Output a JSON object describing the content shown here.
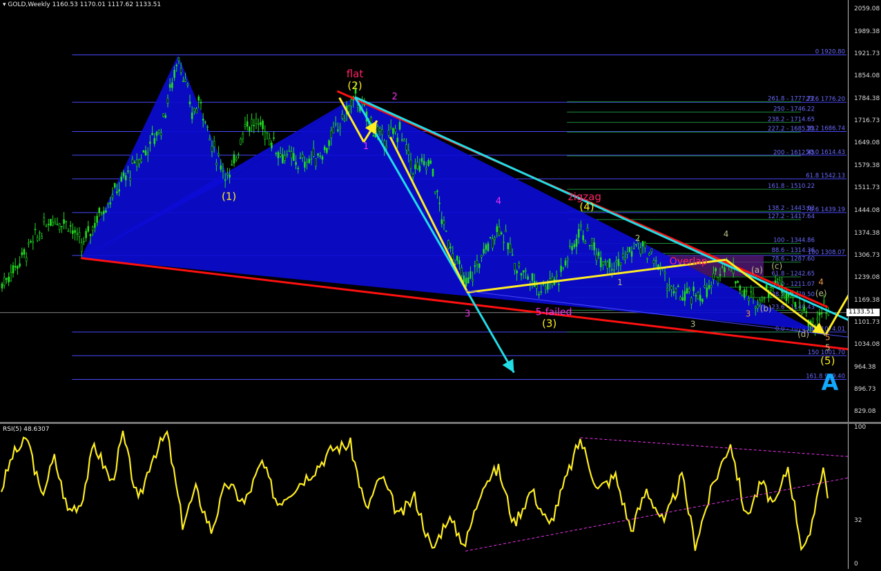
{
  "header": {
    "symbol": "GOLD,Weekly",
    "open": "1160.53",
    "high": "1170.01",
    "low": "1117.62",
    "close": "1133.51"
  },
  "rsi_header": "RSI(5) 48.6307",
  "colors": {
    "candle": "#22dd22",
    "blue_fill": "#0b0bd6",
    "red_line": "#ff1010",
    "cyan": "#22dde6",
    "yellow": "#ffee22",
    "magenta": "#ee33ee",
    "fib_line": "#4a4aff",
    "rsi": "#ffee22"
  },
  "price_scale": [
    "2059.08",
    "1989.38",
    "1921.73",
    "1854.08",
    "1784.38",
    "1716.73",
    "1649.08",
    "1579.38",
    "1511.73",
    "1444.08",
    "1374.38",
    "1306.73",
    "1239.08",
    "1169.38",
    "1101.73",
    "1034.08",
    "964.38",
    "896.73",
    "829.08"
  ],
  "current_price": "1133.51",
  "rsi_scale": [
    "100",
    "32",
    "0"
  ],
  "fib_left": [
    {
      "price": 1920.8,
      "label": "0  1920.80"
    },
    {
      "price": 1776.2,
      "label": "23.6  1776.20"
    },
    {
      "price": 1686.74,
      "label": "38.2  1686.74"
    },
    {
      "price": 1614.43,
      "label": "50.0  1614.43"
    },
    {
      "price": 1542.13,
      "label": "61.8  1542.13"
    },
    {
      "price": 1439.19,
      "label": "78.6  1439.19"
    },
    {
      "price": 1308.07,
      "label": "100  1308.07"
    },
    {
      "price": 1074.01,
      "label": "138.2  1074.01"
    },
    {
      "price": 1001.7,
      "label": "150  1001.70"
    },
    {
      "price": 929.4,
      "label": "161.8  929.40"
    }
  ],
  "fib_right": [
    {
      "price": 1777.72,
      "label": "261.8 - 1777.72"
    },
    {
      "price": 1746.22,
      "label": "250 - 1746.22"
    },
    {
      "price": 1714.65,
      "label": "238.2 - 1714.65"
    },
    {
      "price": 1685.23,
      "label": "227.2 - 1685.23"
    },
    {
      "price": 1612.45,
      "label": "200 - 1612.45"
    },
    {
      "price": 1510.22,
      "label": "161.8 - 1510.22"
    },
    {
      "price": 1443.03,
      "label": "138.2 - 1443.03"
    },
    {
      "price": 1417.64,
      "label": "127.2 - 1417.64"
    },
    {
      "price": 1344.86,
      "label": "100 - 1344.86"
    },
    {
      "price": 1314.36,
      "label": "88.6 - 1314.36"
    },
    {
      "price": 1287.6,
      "label": "78.6 - 1287.60"
    },
    {
      "price": 1242.65,
      "label": "61.8 - 1242.65"
    },
    {
      "price": 1211.07,
      "label": "50.0 - 1211.07"
    },
    {
      "price": 1179.5,
      "label": "38.2 - 1179.50"
    },
    {
      "price": 1140.43,
      "label": "23.6 - 1140.43"
    },
    {
      "price": 1074.01,
      "label": "0.0 - 1074.01"
    }
  ],
  "wave_labels": [
    {
      "text": "flat",
      "price": 1852,
      "bar": 160,
      "color": "#ff2266",
      "size": 15
    },
    {
      "text": "(2)",
      "price": 1816,
      "bar": 160,
      "color": "#ffee22",
      "size": 15
    },
    {
      "text": "2",
      "price": 1785,
      "bar": 178,
      "color": "#ee33ee",
      "size": 13
    },
    {
      "text": "1",
      "price": 1633,
      "bar": 165,
      "color": "#ee33ee",
      "size": 13
    },
    {
      "text": "(1)",
      "price": 1478,
      "bar": 103,
      "color": "#ffee22",
      "size": 15
    },
    {
      "text": "zigzag",
      "price": 1477,
      "bar": 264,
      "color": "#ff2266",
      "size": 15
    },
    {
      "text": "(4)",
      "price": 1446,
      "bar": 265,
      "color": "#ffee22",
      "size": 15
    },
    {
      "text": "4",
      "price": 1465,
      "bar": 225,
      "color": "#ee33ee",
      "size": 13
    },
    {
      "text": "3",
      "price": 1121,
      "bar": 211,
      "color": "#ee33ee",
      "size": 13
    },
    {
      "text": "5-failed",
      "price": 1126,
      "bar": 250,
      "color": "#ee33ee",
      "size": 14
    },
    {
      "text": "(3)",
      "price": 1090,
      "bar": 248,
      "color": "#ffee22",
      "size": 15
    },
    {
      "text": "2",
      "price": 1352,
      "bar": 288,
      "color": "#bbbb88",
      "size": 12
    },
    {
      "text": "1",
      "price": 1217,
      "bar": 280,
      "color": "#bbbb88",
      "size": 12
    },
    {
      "text": "Overlap",
      "price": 1281,
      "bar": 311,
      "color": "#ff2266",
      "size": 14
    },
    {
      "text": "4",
      "price": 1365,
      "bar": 328,
      "color": "#bbbb88",
      "size": 12
    },
    {
      "text": "(a)",
      "price": 1255,
      "bar": 342,
      "color": "#bbbb88",
      "size": 12
    },
    {
      "text": "(c)",
      "price": 1267,
      "bar": 351,
      "color": "#bbbb88",
      "size": 12
    },
    {
      "text": "(b)",
      "price": 1137,
      "bar": 346,
      "color": "#bbbb88",
      "size": 12
    },
    {
      "text": "3",
      "price": 1121,
      "bar": 338,
      "color": "#ee9944",
      "size": 12
    },
    {
      "text": "3",
      "price": 1090,
      "bar": 313,
      "color": "#bbbb88",
      "size": 12
    },
    {
      "text": "4",
      "price": 1218,
      "bar": 371,
      "color": "#ee9944",
      "size": 12
    },
    {
      "text": "(e)",
      "price": 1183,
      "bar": 371,
      "color": "#bbbb88",
      "size": 12
    },
    {
      "text": "(d)",
      "price": 1059,
      "bar": 363,
      "color": "#bbbb88",
      "size": 12
    },
    {
      "text": "5",
      "price": 1050,
      "bar": 374,
      "color": "#ee9944",
      "size": 12
    },
    {
      "text": "5",
      "price": 1018,
      "bar": 374,
      "color": "#bbbb88",
      "size": 12
    },
    {
      "text": "(5)",
      "price": 976,
      "bar": 374,
      "color": "#ffee22",
      "size": 15
    },
    {
      "text": "A",
      "price": 897,
      "bar": 375,
      "color": "#11aaff",
      "size": 32
    }
  ],
  "chart_data": {
    "type": "candlestick",
    "symbol": "GOLD",
    "timeframe": "Weekly",
    "ylim": [
      829.08,
      2059.08
    ],
    "price_anchors": [
      {
        "bar": 0,
        "price": 1220
      },
      {
        "bar": 12,
        "price": 1330
      },
      {
        "bar": 22,
        "price": 1420
      },
      {
        "bar": 30,
        "price": 1410
      },
      {
        "bar": 36,
        "price": 1335
      },
      {
        "bar": 44,
        "price": 1435
      },
      {
        "bar": 54,
        "price": 1530
      },
      {
        "bar": 62,
        "price": 1600
      },
      {
        "bar": 72,
        "price": 1700
      },
      {
        "bar": 80,
        "price": 1920
      },
      {
        "bar": 86,
        "price": 1740
      },
      {
        "bar": 90,
        "price": 1780
      },
      {
        "bar": 95,
        "price": 1640
      },
      {
        "bar": 103,
        "price": 1540
      },
      {
        "bar": 110,
        "price": 1715
      },
      {
        "bar": 118,
        "price": 1700
      },
      {
        "bar": 126,
        "price": 1620
      },
      {
        "bar": 135,
        "price": 1590
      },
      {
        "bar": 145,
        "price": 1620
      },
      {
        "bar": 152,
        "price": 1700
      },
      {
        "bar": 160,
        "price": 1792
      },
      {
        "bar": 166,
        "price": 1720
      },
      {
        "bar": 172,
        "price": 1660
      },
      {
        "bar": 180,
        "price": 1690
      },
      {
        "bar": 186,
        "price": 1570
      },
      {
        "bar": 194,
        "price": 1590
      },
      {
        "bar": 200,
        "price": 1390
      },
      {
        "bar": 210,
        "price": 1215
      },
      {
        "bar": 216,
        "price": 1290
      },
      {
        "bar": 225,
        "price": 1400
      },
      {
        "bar": 233,
        "price": 1275
      },
      {
        "bar": 243,
        "price": 1210
      },
      {
        "bar": 252,
        "price": 1245
      },
      {
        "bar": 262,
        "price": 1390
      },
      {
        "bar": 270,
        "price": 1310
      },
      {
        "bar": 278,
        "price": 1280
      },
      {
        "bar": 288,
        "price": 1340
      },
      {
        "bar": 296,
        "price": 1290
      },
      {
        "bar": 304,
        "price": 1190
      },
      {
        "bar": 312,
        "price": 1180
      },
      {
        "bar": 320,
        "price": 1200
      },
      {
        "bar": 328,
        "price": 1300
      },
      {
        "bar": 336,
        "price": 1190
      },
      {
        "bar": 342,
        "price": 1165
      },
      {
        "bar": 350,
        "price": 1230
      },
      {
        "bar": 358,
        "price": 1185
      },
      {
        "bar": 364,
        "price": 1130
      },
      {
        "bar": 368,
        "price": 1080
      },
      {
        "bar": 372,
        "price": 1160
      },
      {
        "bar": 374,
        "price": 1133
      }
    ],
    "bars_visible": 375,
    "patterns": [
      {
        "name": "blue-harmonic",
        "type": "polygon",
        "points": [
          [
            36,
            1300
          ],
          [
            80,
            1920
          ],
          [
            103,
            1540
          ],
          [
            160,
            1792
          ],
          [
            368,
            1080
          ]
        ]
      },
      {
        "name": "blue-harmonic-base",
        "type": "polygon",
        "points": [
          [
            36,
            1300
          ],
          [
            103,
            1540
          ],
          [
            160,
            1792
          ]
        ]
      }
    ],
    "lines": [
      {
        "name": "red-upper-trendline",
        "color": "#ff1010",
        "from": [
          152,
          1810
        ],
        "to": [
          374,
          1150
        ]
      },
      {
        "name": "cyan-upper-trendline",
        "color": "#22dde6",
        "from": [
          160,
          1792
        ],
        "to": [
          400,
          1060
        ]
      },
      {
        "name": "red-lower-trendline",
        "color": "#ff1010",
        "from": [
          36,
          1300
        ],
        "to": [
          410,
          1000
        ]
      },
      {
        "name": "cyan-wave3-line",
        "color": "#22dde6",
        "from": [
          160,
          1792
        ],
        "to": [
          232,
          950
        ]
      },
      {
        "name": "yellow-wave-1",
        "color": "#ffee22",
        "from": [
          153,
          1790
        ],
        "to": [
          164,
          1655
        ]
      },
      {
        "name": "yellow-wave-2",
        "color": "#ffee22",
        "from": [
          164,
          1655
        ],
        "to": [
          170,
          1720
        ]
      },
      {
        "name": "yellow-wave-3",
        "color": "#ffee22",
        "from": [
          176,
          1670
        ],
        "to": [
          211,
          1195
        ]
      },
      {
        "name": "yellow-wave-4",
        "color": "#ffee22",
        "from": [
          211,
          1195
        ],
        "to": [
          328,
          1295
        ]
      },
      {
        "name": "yellow-wave-5",
        "color": "#ffee22",
        "from": [
          328,
          1295
        ],
        "to": [
          373,
          1065
        ]
      },
      {
        "name": "yellow-projection",
        "color": "#ffee22",
        "from": [
          373,
          1065
        ],
        "to": [
          418,
          1590
        ]
      },
      {
        "name": "blue-thin-lower",
        "color": "#4a4aff",
        "from": [
          210,
          1200
        ],
        "to": [
          400,
          1045
        ]
      }
    ],
    "overlap_zone": {
      "bar_from": 278,
      "bar_to": 345,
      "price_low": 1245,
      "price_high": 1308
    },
    "rsi": {
      "period": 5,
      "last_value": 48.6307,
      "ylim": [
        0,
        100
      ],
      "levels": [
        0,
        32,
        100
      ],
      "anchors": [
        {
          "bar": 0,
          "value": 55
        },
        {
          "bar": 5,
          "value": 80
        },
        {
          "bar": 12,
          "value": 92
        },
        {
          "bar": 18,
          "value": 50
        },
        {
          "bar": 24,
          "value": 78
        },
        {
          "bar": 30,
          "value": 40
        },
        {
          "bar": 36,
          "value": 45
        },
        {
          "bar": 42,
          "value": 88
        },
        {
          "bar": 50,
          "value": 60
        },
        {
          "bar": 55,
          "value": 95
        },
        {
          "bar": 62,
          "value": 45
        },
        {
          "bar": 68,
          "value": 78
        },
        {
          "bar": 75,
          "value": 96
        },
        {
          "bar": 82,
          "value": 30
        },
        {
          "bar": 88,
          "value": 55
        },
        {
          "bar": 95,
          "value": 25
        },
        {
          "bar": 102,
          "value": 60
        },
        {
          "bar": 110,
          "value": 45
        },
        {
          "bar": 118,
          "value": 75
        },
        {
          "bar": 125,
          "value": 45
        },
        {
          "bar": 135,
          "value": 60
        },
        {
          "bar": 142,
          "value": 70
        },
        {
          "bar": 150,
          "value": 85
        },
        {
          "bar": 158,
          "value": 88
        },
        {
          "bar": 165,
          "value": 40
        },
        {
          "bar": 172,
          "value": 65
        },
        {
          "bar": 180,
          "value": 35
        },
        {
          "bar": 187,
          "value": 50
        },
        {
          "bar": 195,
          "value": 10
        },
        {
          "bar": 202,
          "value": 35
        },
        {
          "bar": 210,
          "value": 15
        },
        {
          "bar": 218,
          "value": 60
        },
        {
          "bar": 225,
          "value": 70
        },
        {
          "bar": 232,
          "value": 30
        },
        {
          "bar": 240,
          "value": 55
        },
        {
          "bar": 248,
          "value": 28
        },
        {
          "bar": 255,
          "value": 60
        },
        {
          "bar": 262,
          "value": 92
        },
        {
          "bar": 270,
          "value": 55
        },
        {
          "bar": 278,
          "value": 65
        },
        {
          "bar": 285,
          "value": 25
        },
        {
          "bar": 292,
          "value": 55
        },
        {
          "bar": 300,
          "value": 30
        },
        {
          "bar": 308,
          "value": 65
        },
        {
          "bar": 314,
          "value": 15
        },
        {
          "bar": 322,
          "value": 58
        },
        {
          "bar": 330,
          "value": 90
        },
        {
          "bar": 337,
          "value": 35
        },
        {
          "bar": 344,
          "value": 60
        },
        {
          "bar": 350,
          "value": 42
        },
        {
          "bar": 356,
          "value": 72
        },
        {
          "bar": 362,
          "value": 15
        },
        {
          "bar": 366,
          "value": 18
        },
        {
          "bar": 370,
          "value": 60
        },
        {
          "bar": 372,
          "value": 72
        },
        {
          "bar": 374,
          "value": 48.6
        }
      ],
      "trendlines": [
        {
          "name": "rsi-upper-trend",
          "from": [
            262,
            93
          ],
          "to": [
            420,
            75
          ]
        },
        {
          "name": "rsi-lower-trend",
          "from": [
            210,
            10
          ],
          "to": [
            420,
            75
          ]
        }
      ]
    }
  }
}
